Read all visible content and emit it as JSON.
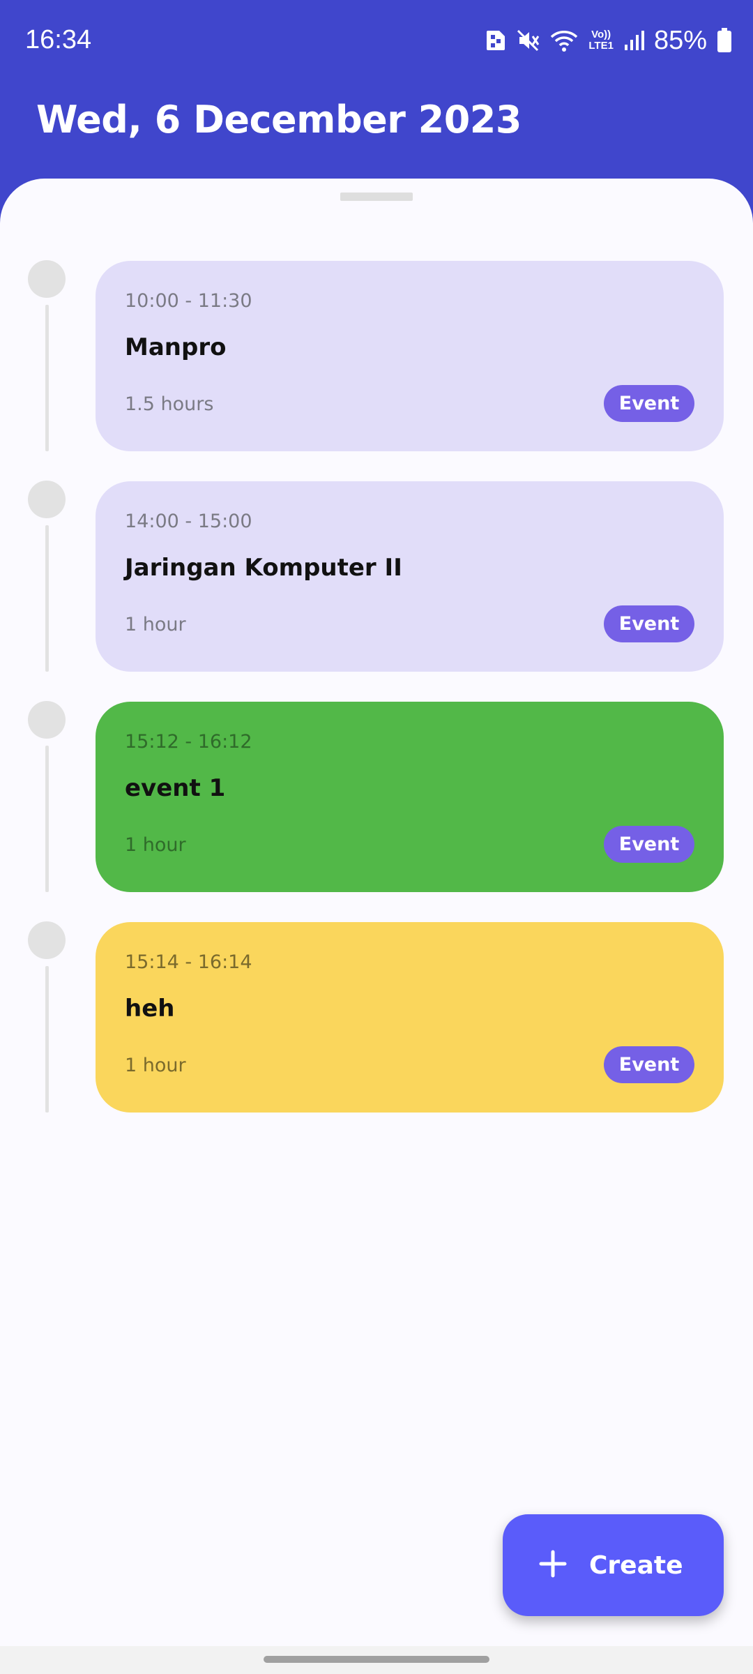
{
  "status_bar": {
    "time": "16:34",
    "volte_label": "Vo))\nLTE1",
    "battery": "85%",
    "icons": [
      "sim-card-icon",
      "mute-icon",
      "wifi-icon",
      "volte-icon",
      "signal-icon",
      "battery-icon"
    ]
  },
  "header": {
    "date": "Wed, 6 December 2023"
  },
  "events": [
    {
      "time": "10:00 -  11:30",
      "title": "Manpro",
      "duration": "1.5 hours",
      "badge": "Event",
      "color": "#e1ddf9"
    },
    {
      "time": "14:00 -  15:00",
      "title": "Jaringan Komputer II",
      "duration": "1 hour",
      "badge": "Event",
      "color": "#e1ddf9"
    },
    {
      "time": "15:12 -  16:12",
      "title": "event 1",
      "duration": "1 hour",
      "badge": "Event",
      "color": "#52b848"
    },
    {
      "time": "15:14 -  16:14",
      "title": "heh",
      "duration": "1 hour",
      "badge": "Event",
      "color": "#fad65c"
    }
  ],
  "fab": {
    "label": "Create",
    "icon": "plus-icon"
  },
  "colors": {
    "header_bg": "#4046cc",
    "badge": "#7560e6",
    "fab": "#5a5cfa"
  }
}
